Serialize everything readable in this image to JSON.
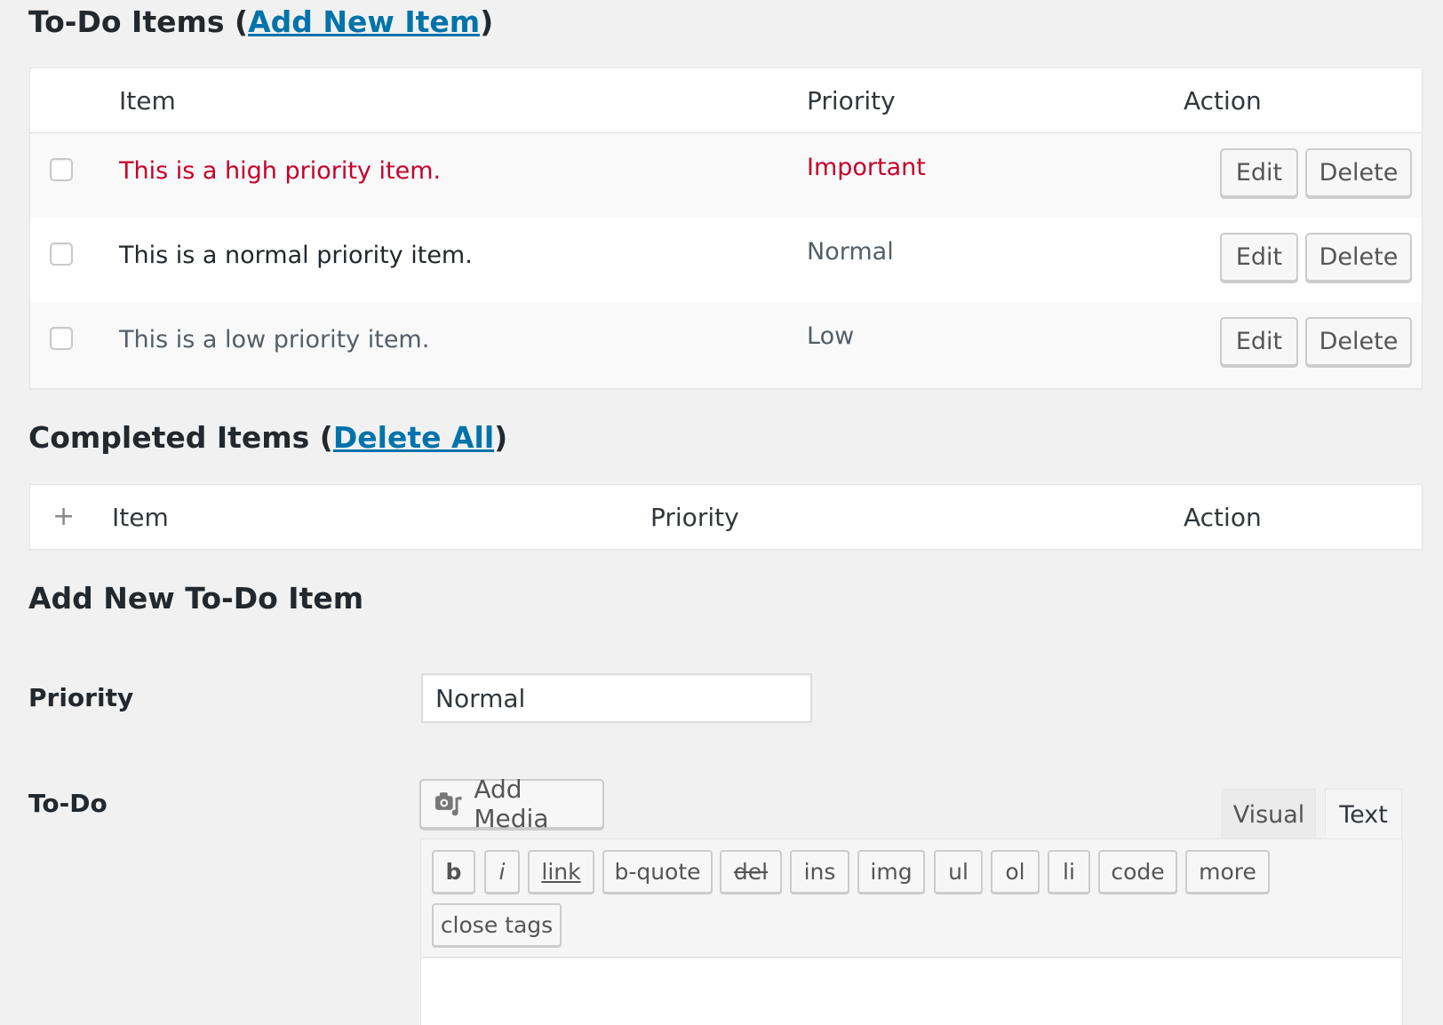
{
  "todo_section": {
    "title_prefix": "To-Do Items (",
    "link": "Add New Item",
    "title_suffix": ")"
  },
  "todo_table": {
    "headers": {
      "item": "Item",
      "priority": "Priority",
      "action": "Action"
    },
    "rows": [
      {
        "item": "This is a high priority item.",
        "priority": "Important",
        "edit": "Edit",
        "delete": "Delete"
      },
      {
        "item": "This is a normal priority item.",
        "priority": "Normal",
        "edit": "Edit",
        "delete": "Delete"
      },
      {
        "item": "This is a low priority item.",
        "priority": "Low",
        "edit": "Edit",
        "delete": "Delete"
      }
    ]
  },
  "completed_section": {
    "title_prefix": "Completed Items (",
    "link": "Delete All",
    "title_suffix": ")"
  },
  "completed_table": {
    "expand_icon": "+",
    "headers": {
      "item": "Item",
      "priority": "Priority",
      "action": "Action"
    }
  },
  "add_form": {
    "title": "Add New To-Do Item",
    "priority_label": "Priority",
    "priority_value": "Normal",
    "todo_label": "To-Do",
    "add_media": "Add Media",
    "tabs": {
      "visual": "Visual",
      "text": "Text"
    },
    "quicktags": [
      "b",
      "i",
      "link",
      "b-quote",
      "del",
      "ins",
      "img",
      "ul",
      "ol",
      "li",
      "code",
      "more",
      "close tags"
    ]
  },
  "colors": {
    "link": "#0073aa",
    "high_priority": "#c4002b",
    "low_priority": "#555d66",
    "background": "#f1f1f1"
  }
}
